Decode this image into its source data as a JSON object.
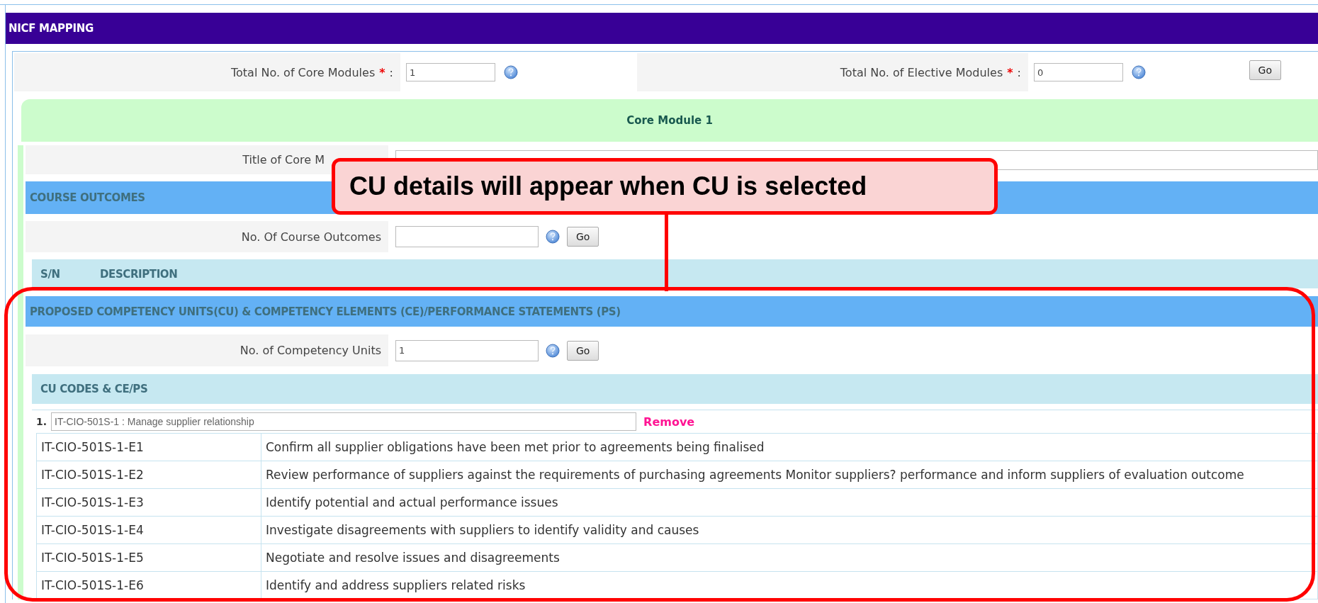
{
  "header": {
    "title": "NICF MAPPING"
  },
  "module_totals": [
    {
      "label": "Total No. of Core Modules",
      "required_mark": "*",
      "separator": ":",
      "value": "1"
    },
    {
      "label": "Total No. of Elective Modules",
      "required_mark": "*",
      "separator": ":",
      "value": "0"
    }
  ],
  "totals_button": "Go",
  "core_module": {
    "title": "Core Module 1",
    "title_label": "Title of Core M",
    "course_outcomes": {
      "heading": "COURSE OUTCOMES",
      "count_label": "No. Of Course Outcomes",
      "button": "Go",
      "columns": [
        "S/N",
        "DESCRIPTION"
      ]
    },
    "competency": {
      "heading": "PROPOSED COMPETENCY UNITS(CU) & COMPETENCY ELEMENTS (CE)/PERFORMANCE STATEMENTS (PS)",
      "count_label": "No. of Competency Units",
      "count_value": "1",
      "button": "Go",
      "subheading": "CU CODES & CE/PS",
      "units": [
        {
          "number": "1.",
          "value": "IT-CIO-501S-1 : Manage supplier relationship",
          "remove": "Remove",
          "elements": [
            {
              "code": "IT-CIO-501S-1-E1",
              "description": "Confirm all supplier obligations have been met prior to agreements being finalised"
            },
            {
              "code": "IT-CIO-501S-1-E2",
              "description": "Review performance of suppliers against the requirements of purchasing agreements Monitor suppliers? performance and inform suppliers of evaluation outcome"
            },
            {
              "code": "IT-CIO-501S-1-E3",
              "description": "Identify potential and actual performance issues"
            },
            {
              "code": "IT-CIO-501S-1-E4",
              "description": "Investigate disagreements with suppliers to identify validity and causes"
            },
            {
              "code": "IT-CIO-501S-1-E5",
              "description": "Negotiate and resolve issues and disagreements"
            },
            {
              "code": "IT-CIO-501S-1-E6",
              "description": "Identify and address suppliers related risks"
            }
          ]
        }
      ]
    }
  },
  "callout": {
    "text": "CU details will appear when CU is selected"
  }
}
